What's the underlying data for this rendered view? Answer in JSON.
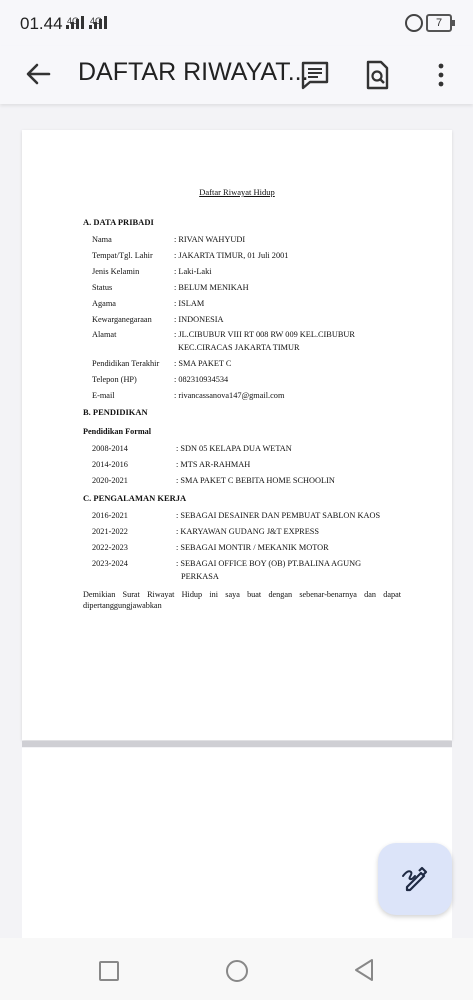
{
  "status_bar": {
    "time": "01.44",
    "sig1": "4G",
    "sig2": "4G",
    "battery": "7"
  },
  "app_bar": {
    "title": "DAFTAR RIWAYAT..."
  },
  "document": {
    "title": "Daftar Riwayat Hidup",
    "section_a": "A. DATA PRIBADI",
    "personal": [
      {
        "label": "Nama",
        "value": ": RIVAN WAHYUDI"
      },
      {
        "label": "Tempat/Tgl. Lahir",
        "value": ": JAKARTA TIMUR, 01 Juli 2001"
      },
      {
        "label": "Jenis Kelamin",
        "value": ": Laki-Laki"
      },
      {
        "label": "Status",
        "value": ": BELUM MENIKAH"
      },
      {
        "label": "Agama",
        "value": ": ISLAM"
      },
      {
        "label": "Kewarganegaraan",
        "value": ": INDONESIA"
      },
      {
        "label": "Alamat",
        "value": ": JL.CIBUBUR VIII RT 008 RW 009 KEL.CIBUBUR",
        "value2": "KEC.CIRACAS JAKARTA TIMUR"
      },
      {
        "label": "Pendidikan Terakhir",
        "value": ": SMA PAKET C"
      },
      {
        "label": "Telepon (HP)",
        "value": ": 082310934534"
      },
      {
        "label": "E-mail",
        "value": ": rivancassanova147@gmail.com"
      }
    ],
    "section_b": "B. PENDIDIKAN",
    "sub_b": "Pendidikan Formal",
    "education": [
      {
        "label": "2008-2014",
        "value": ": SDN 05 KELAPA DUA WETAN"
      },
      {
        "label": "2014-2016",
        "value": ": MTS AR-RAHMAH"
      },
      {
        "label": "2020-2021",
        "value": ": SMA PAKET C BEBITA HOME SCHOOLIN"
      }
    ],
    "section_c": "C. PENGALAMAN KERJA",
    "work": [
      {
        "label": "2016-2021",
        "value": ": SEBAGAI DESAINER DAN PEMBUAT SABLON KAOS"
      },
      {
        "label": "2021-2022",
        "value": ": KARYAWAN GUDANG J&T EXPRESS"
      },
      {
        "label": "2022-2023",
        "value": ": SEBAGAI MONTIR / MEKANIK MOTOR"
      },
      {
        "label": "2023-2024",
        "value": ": SEBAGAI OFFICE BOY (OB) PT.BALINA AGUNG",
        "value2": "PERKASA"
      }
    ],
    "closing": "Demikian Surat Riwayat Hidup ini saya buat dengan sebenar-benarnya dan dapat dipertanggungjawabkan"
  }
}
